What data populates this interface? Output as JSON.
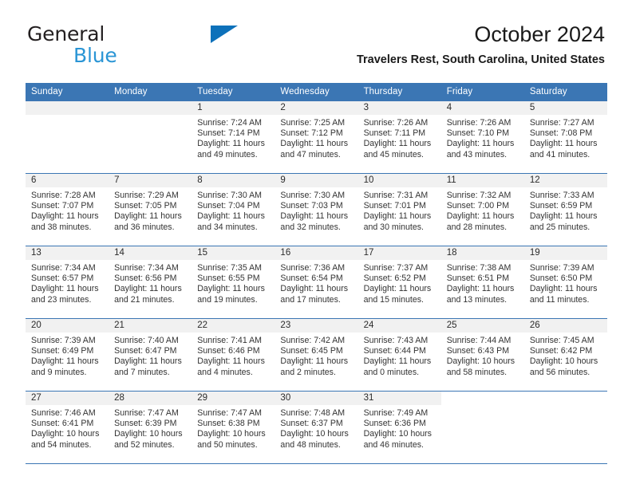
{
  "brand": {
    "name_top": "General",
    "name_bottom": "Blue",
    "triangle_color": "#0d71ba",
    "bottom_color": "#2a95d5"
  },
  "header": {
    "title": "October 2024",
    "subtitle": "Travelers Rest, South Carolina, United States"
  },
  "theme": {
    "header_blue": "#3b76b4",
    "daynum_band": "#f1f1f1",
    "text": "#333333"
  },
  "calendar": {
    "weekday_headers": [
      "Sunday",
      "Monday",
      "Tuesday",
      "Wednesday",
      "Thursday",
      "Friday",
      "Saturday"
    ],
    "weeks": [
      [
        {
          "day": "",
          "sunrise": "",
          "sunset": "",
          "daylight_1": "",
          "daylight_2": "",
          "state": "empty"
        },
        {
          "day": "",
          "sunrise": "",
          "sunset": "",
          "daylight_1": "",
          "daylight_2": "",
          "state": "empty"
        },
        {
          "day": "1",
          "sunrise": "Sunrise: 7:24 AM",
          "sunset": "Sunset: 7:14 PM",
          "daylight_1": "Daylight: 11 hours",
          "daylight_2": "and 49 minutes.",
          "state": "filled"
        },
        {
          "day": "2",
          "sunrise": "Sunrise: 7:25 AM",
          "sunset": "Sunset: 7:12 PM",
          "daylight_1": "Daylight: 11 hours",
          "daylight_2": "and 47 minutes.",
          "state": "filled"
        },
        {
          "day": "3",
          "sunrise": "Sunrise: 7:26 AM",
          "sunset": "Sunset: 7:11 PM",
          "daylight_1": "Daylight: 11 hours",
          "daylight_2": "and 45 minutes.",
          "state": "filled"
        },
        {
          "day": "4",
          "sunrise": "Sunrise: 7:26 AM",
          "sunset": "Sunset: 7:10 PM",
          "daylight_1": "Daylight: 11 hours",
          "daylight_2": "and 43 minutes.",
          "state": "filled"
        },
        {
          "day": "5",
          "sunrise": "Sunrise: 7:27 AM",
          "sunset": "Sunset: 7:08 PM",
          "daylight_1": "Daylight: 11 hours",
          "daylight_2": "and 41 minutes.",
          "state": "filled"
        }
      ],
      [
        {
          "day": "6",
          "sunrise": "Sunrise: 7:28 AM",
          "sunset": "Sunset: 7:07 PM",
          "daylight_1": "Daylight: 11 hours",
          "daylight_2": "and 38 minutes.",
          "state": "filled"
        },
        {
          "day": "7",
          "sunrise": "Sunrise: 7:29 AM",
          "sunset": "Sunset: 7:05 PM",
          "daylight_1": "Daylight: 11 hours",
          "daylight_2": "and 36 minutes.",
          "state": "filled"
        },
        {
          "day": "8",
          "sunrise": "Sunrise: 7:30 AM",
          "sunset": "Sunset: 7:04 PM",
          "daylight_1": "Daylight: 11 hours",
          "daylight_2": "and 34 minutes.",
          "state": "filled"
        },
        {
          "day": "9",
          "sunrise": "Sunrise: 7:30 AM",
          "sunset": "Sunset: 7:03 PM",
          "daylight_1": "Daylight: 11 hours",
          "daylight_2": "and 32 minutes.",
          "state": "filled"
        },
        {
          "day": "10",
          "sunrise": "Sunrise: 7:31 AM",
          "sunset": "Sunset: 7:01 PM",
          "daylight_1": "Daylight: 11 hours",
          "daylight_2": "and 30 minutes.",
          "state": "filled"
        },
        {
          "day": "11",
          "sunrise": "Sunrise: 7:32 AM",
          "sunset": "Sunset: 7:00 PM",
          "daylight_1": "Daylight: 11 hours",
          "daylight_2": "and 28 minutes.",
          "state": "filled"
        },
        {
          "day": "12",
          "sunrise": "Sunrise: 7:33 AM",
          "sunset": "Sunset: 6:59 PM",
          "daylight_1": "Daylight: 11 hours",
          "daylight_2": "and 25 minutes.",
          "state": "filled"
        }
      ],
      [
        {
          "day": "13",
          "sunrise": "Sunrise: 7:34 AM",
          "sunset": "Sunset: 6:57 PM",
          "daylight_1": "Daylight: 11 hours",
          "daylight_2": "and 23 minutes.",
          "state": "filled"
        },
        {
          "day": "14",
          "sunrise": "Sunrise: 7:34 AM",
          "sunset": "Sunset: 6:56 PM",
          "daylight_1": "Daylight: 11 hours",
          "daylight_2": "and 21 minutes.",
          "state": "filled"
        },
        {
          "day": "15",
          "sunrise": "Sunrise: 7:35 AM",
          "sunset": "Sunset: 6:55 PM",
          "daylight_1": "Daylight: 11 hours",
          "daylight_2": "and 19 minutes.",
          "state": "filled"
        },
        {
          "day": "16",
          "sunrise": "Sunrise: 7:36 AM",
          "sunset": "Sunset: 6:54 PM",
          "daylight_1": "Daylight: 11 hours",
          "daylight_2": "and 17 minutes.",
          "state": "filled"
        },
        {
          "day": "17",
          "sunrise": "Sunrise: 7:37 AM",
          "sunset": "Sunset: 6:52 PM",
          "daylight_1": "Daylight: 11 hours",
          "daylight_2": "and 15 minutes.",
          "state": "filled"
        },
        {
          "day": "18",
          "sunrise": "Sunrise: 7:38 AM",
          "sunset": "Sunset: 6:51 PM",
          "daylight_1": "Daylight: 11 hours",
          "daylight_2": "and 13 minutes.",
          "state": "filled"
        },
        {
          "day": "19",
          "sunrise": "Sunrise: 7:39 AM",
          "sunset": "Sunset: 6:50 PM",
          "daylight_1": "Daylight: 11 hours",
          "daylight_2": "and 11 minutes.",
          "state": "filled"
        }
      ],
      [
        {
          "day": "20",
          "sunrise": "Sunrise: 7:39 AM",
          "sunset": "Sunset: 6:49 PM",
          "daylight_1": "Daylight: 11 hours",
          "daylight_2": "and 9 minutes.",
          "state": "filled"
        },
        {
          "day": "21",
          "sunrise": "Sunrise: 7:40 AM",
          "sunset": "Sunset: 6:47 PM",
          "daylight_1": "Daylight: 11 hours",
          "daylight_2": "and 7 minutes.",
          "state": "filled"
        },
        {
          "day": "22",
          "sunrise": "Sunrise: 7:41 AM",
          "sunset": "Sunset: 6:46 PM",
          "daylight_1": "Daylight: 11 hours",
          "daylight_2": "and 4 minutes.",
          "state": "filled"
        },
        {
          "day": "23",
          "sunrise": "Sunrise: 7:42 AM",
          "sunset": "Sunset: 6:45 PM",
          "daylight_1": "Daylight: 11 hours",
          "daylight_2": "and 2 minutes.",
          "state": "filled"
        },
        {
          "day": "24",
          "sunrise": "Sunrise: 7:43 AM",
          "sunset": "Sunset: 6:44 PM",
          "daylight_1": "Daylight: 11 hours",
          "daylight_2": "and 0 minutes.",
          "state": "filled"
        },
        {
          "day": "25",
          "sunrise": "Sunrise: 7:44 AM",
          "sunset": "Sunset: 6:43 PM",
          "daylight_1": "Daylight: 10 hours",
          "daylight_2": "and 58 minutes.",
          "state": "filled"
        },
        {
          "day": "26",
          "sunrise": "Sunrise: 7:45 AM",
          "sunset": "Sunset: 6:42 PM",
          "daylight_1": "Daylight: 10 hours",
          "daylight_2": "and 56 minutes.",
          "state": "filled"
        }
      ],
      [
        {
          "day": "27",
          "sunrise": "Sunrise: 7:46 AM",
          "sunset": "Sunset: 6:41 PM",
          "daylight_1": "Daylight: 10 hours",
          "daylight_2": "and 54 minutes.",
          "state": "filled"
        },
        {
          "day": "28",
          "sunrise": "Sunrise: 7:47 AM",
          "sunset": "Sunset: 6:39 PM",
          "daylight_1": "Daylight: 10 hours",
          "daylight_2": "and 52 minutes.",
          "state": "filled"
        },
        {
          "day": "29",
          "sunrise": "Sunrise: 7:47 AM",
          "sunset": "Sunset: 6:38 PM",
          "daylight_1": "Daylight: 10 hours",
          "daylight_2": "and 50 minutes.",
          "state": "filled"
        },
        {
          "day": "30",
          "sunrise": "Sunrise: 7:48 AM",
          "sunset": "Sunset: 6:37 PM",
          "daylight_1": "Daylight: 10 hours",
          "daylight_2": "and 48 minutes.",
          "state": "filled"
        },
        {
          "day": "31",
          "sunrise": "Sunrise: 7:49 AM",
          "sunset": "Sunset: 6:36 PM",
          "daylight_1": "Daylight: 10 hours",
          "daylight_2": "and 46 minutes.",
          "state": "filled"
        },
        {
          "day": "",
          "sunrise": "",
          "sunset": "",
          "daylight_1": "",
          "daylight_2": "",
          "state": "blank"
        },
        {
          "day": "",
          "sunrise": "",
          "sunset": "",
          "daylight_1": "",
          "daylight_2": "",
          "state": "blank"
        }
      ]
    ]
  }
}
